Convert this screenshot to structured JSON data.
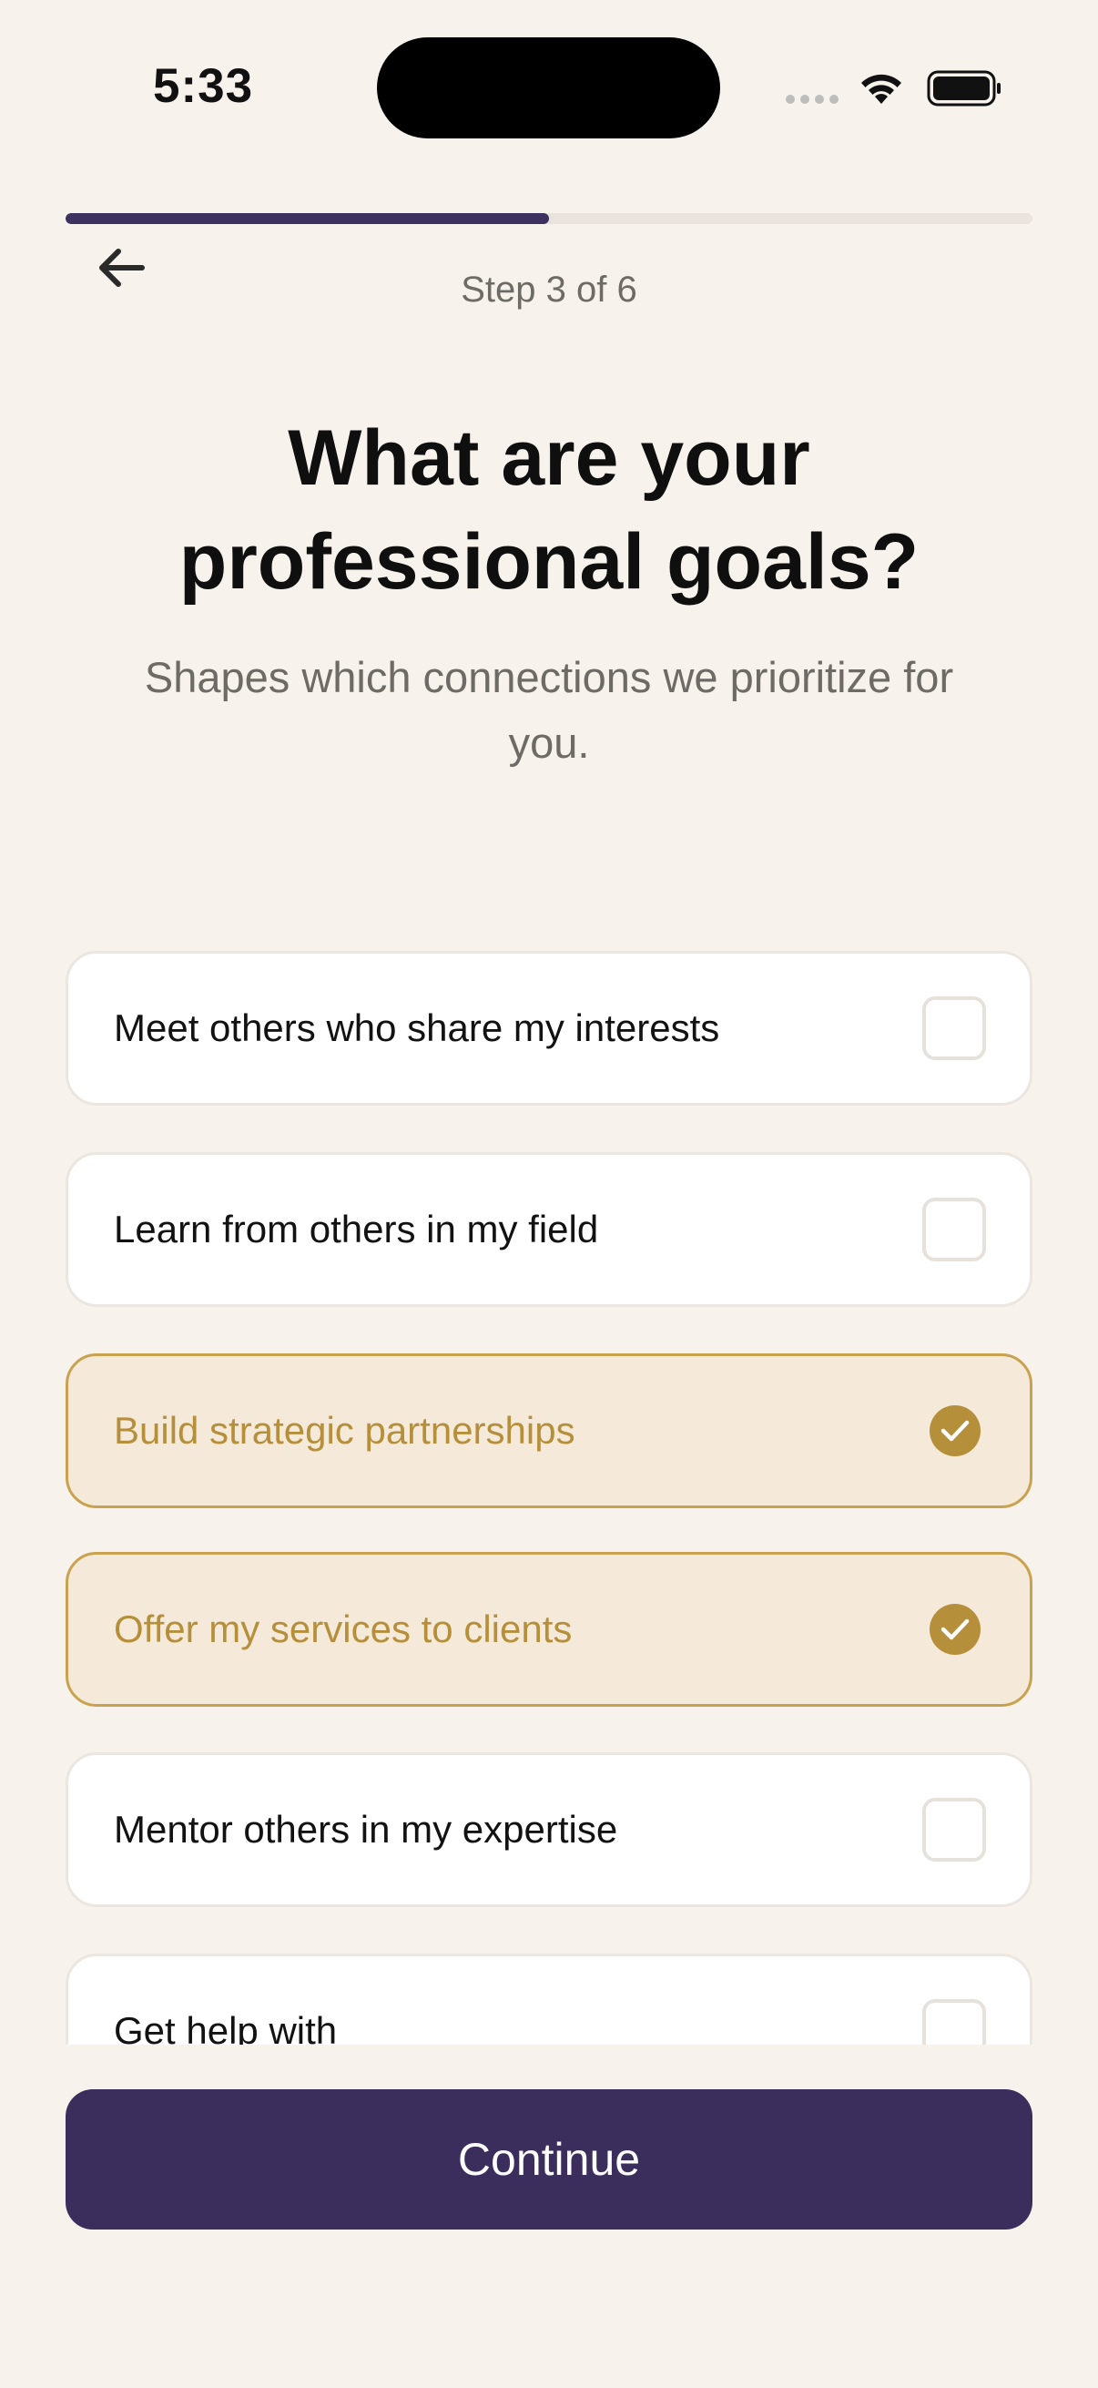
{
  "status_bar": {
    "time": "5:33",
    "icons": [
      "signal-dots-icon",
      "wifi-icon",
      "battery-icon"
    ]
  },
  "progress": {
    "current_step": 3,
    "total_steps": 6,
    "fraction": 0.5,
    "step_label": "Step 3 of 6",
    "fill_color": "#3d3160"
  },
  "header": {
    "back_icon": "arrow-left-icon",
    "title": "What are your professional goals?",
    "subtitle": "Shapes which connections we prioritize for you."
  },
  "options": [
    {
      "label": "Meet others who share my interests",
      "selected": false
    },
    {
      "label": "Learn from others in my field",
      "selected": false
    },
    {
      "label": "Build strategic partnerships",
      "selected": true
    },
    {
      "label": "Offer my services to clients",
      "selected": true
    },
    {
      "label": "Mentor others in my expertise",
      "selected": false
    },
    {
      "label": "Get help with",
      "selected": false
    }
  ],
  "continue_button": {
    "label": "Continue",
    "color": "#3b2e5c"
  },
  "colors": {
    "background": "#f7f2ec",
    "selected_accent": "#b68f3a",
    "selected_background": "#f5eada"
  }
}
